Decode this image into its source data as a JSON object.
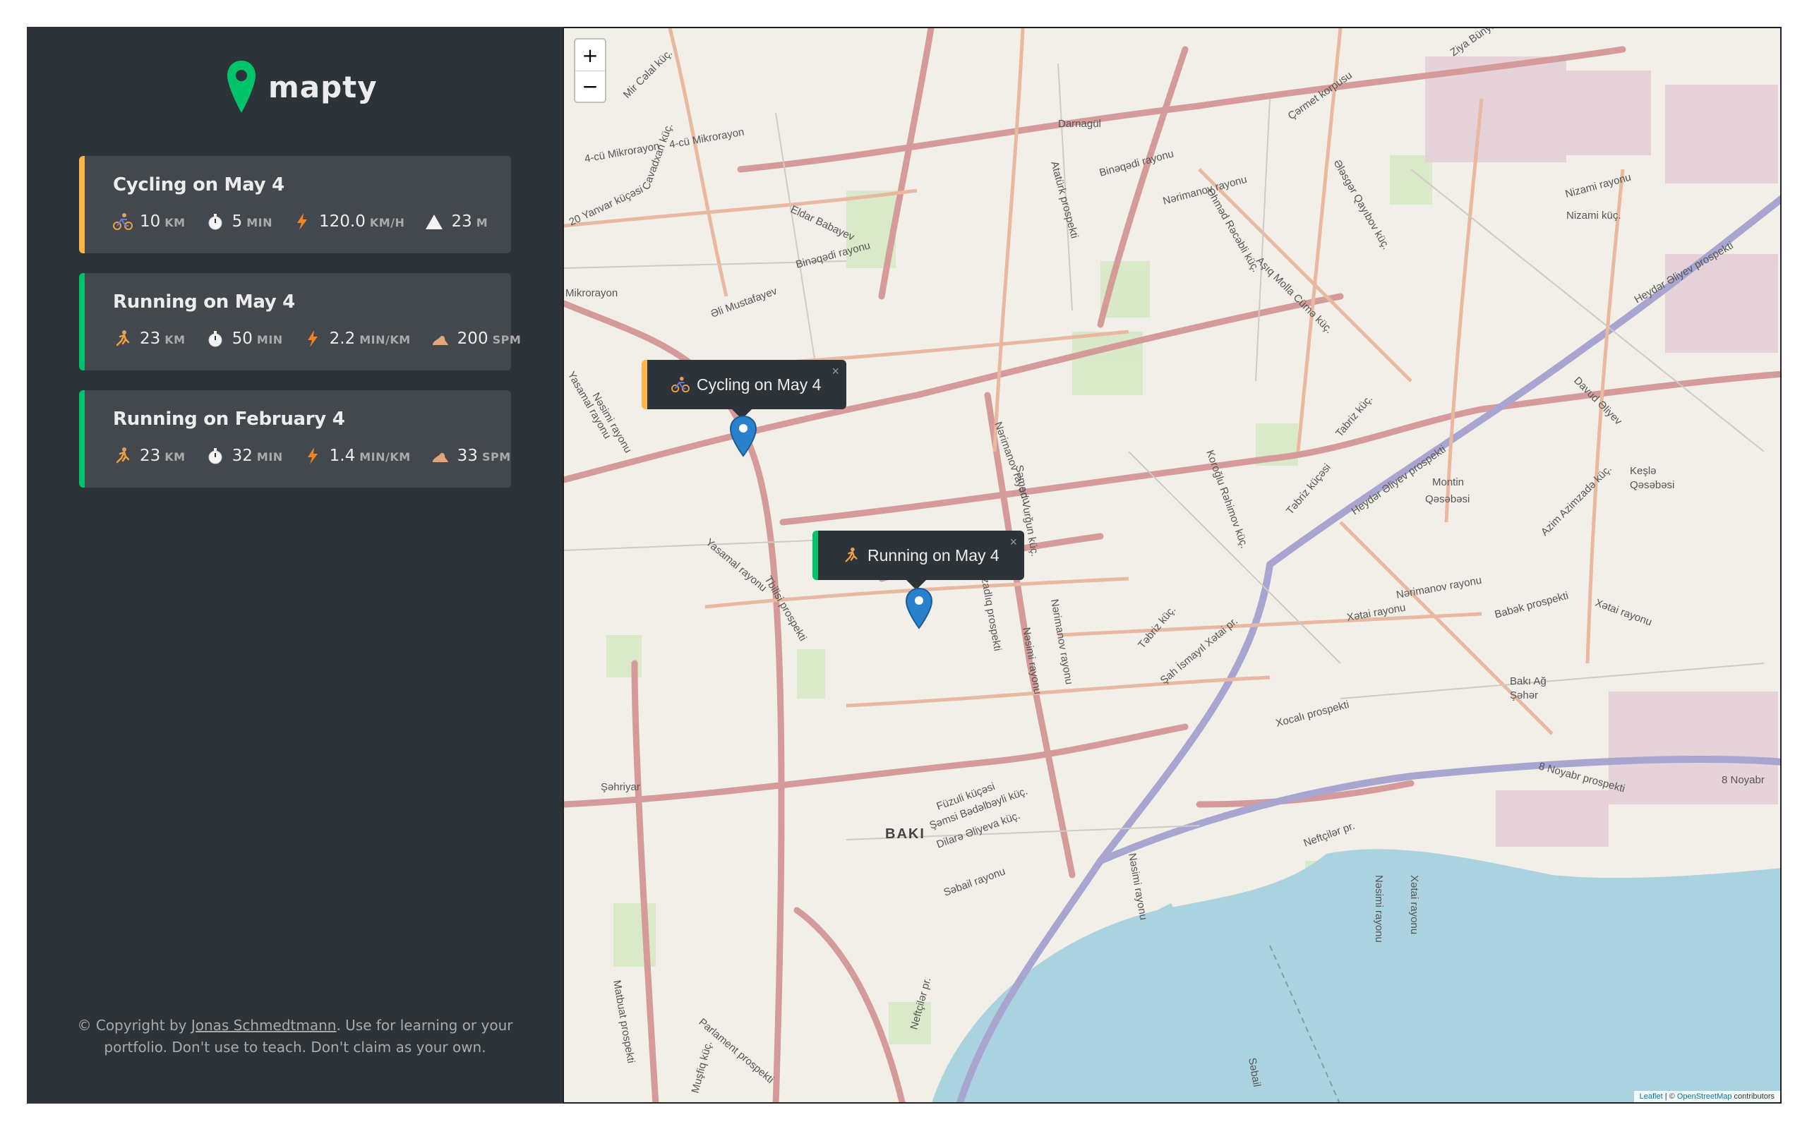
{
  "app": {
    "name": "mapty"
  },
  "colors": {
    "sidebar_bg": "#2d3439",
    "card_bg": "#42484d",
    "cycling": "#ffb545",
    "running": "#00c46a",
    "marker": "#2a81cb",
    "water": "#aad3df"
  },
  "workouts": [
    {
      "type": "cycling",
      "title": "Cycling on May 4",
      "icon": "cyclist-icon",
      "details": [
        {
          "icon": "cyclist-icon",
          "value": "10",
          "unit": "km"
        },
        {
          "icon": "stopwatch-icon",
          "value": "5",
          "unit": "min"
        },
        {
          "icon": "lightning-icon",
          "value": "120.0",
          "unit": "km/h"
        },
        {
          "icon": "mountain-icon",
          "value": "23",
          "unit": "m"
        }
      ]
    },
    {
      "type": "running",
      "title": "Running on May 4",
      "icon": "runner-icon",
      "details": [
        {
          "icon": "runner-icon",
          "value": "23",
          "unit": "km"
        },
        {
          "icon": "stopwatch-icon",
          "value": "50",
          "unit": "min"
        },
        {
          "icon": "lightning-icon",
          "value": "2.2",
          "unit": "min/km"
        },
        {
          "icon": "footprint-icon",
          "value": "200",
          "unit": "spm"
        }
      ]
    },
    {
      "type": "running",
      "title": "Running on February 4",
      "icon": "runner-icon",
      "details": [
        {
          "icon": "runner-icon",
          "value": "23",
          "unit": "km"
        },
        {
          "icon": "stopwatch-icon",
          "value": "32",
          "unit": "min"
        },
        {
          "icon": "lightning-icon",
          "value": "1.4",
          "unit": "min/km"
        },
        {
          "icon": "footprint-icon",
          "value": "33",
          "unit": "spm"
        }
      ]
    }
  ],
  "copyright": {
    "prefix": "© Copyright by ",
    "link": "Jonas Schmedtmann",
    "suffix": ". Use for learning or your portfolio. Don't use to teach. Don't claim as your own."
  },
  "map": {
    "zoom_in": "+",
    "zoom_out": "−",
    "popups": [
      {
        "type": "cycling",
        "label": "Cycling on May 4",
        "icon": "cyclist-icon",
        "close": "×"
      },
      {
        "type": "running",
        "label": "Running on May 4",
        "icon": "runner-icon",
        "close": "×"
      }
    ],
    "labels": [
      "Darnagül",
      "4-cü Mikrorayon",
      "4-cü Mikrorayon",
      "Mir Cəlal küç.",
      "20 Yanvar küçəsi",
      "Cavadxan küç.",
      "Eldar Babayev",
      "Binəqədi rayonu",
      "Binəqədi rayonu",
      "Nərimanov rayonu",
      "Atatürk prospekti",
      "Əhməd Rəcəbli küç.",
      "Aşıq Molla Cümə küç.",
      "Çərmet korpusu",
      "Ziya Bünyad",
      "Nizami rayonu",
      "Ələsgər Qayıbov küç.",
      "Heydər Əliyev prospekti",
      "Mikrorayon",
      "Əli Mustafayev",
      "Yasamal rayonu",
      "Nəsimi rayonu",
      "Nərimanov rayonu",
      "Səməd Vurğun küç.",
      "Koroğlu Rəhimov küç.",
      "Təbriz küçəsi",
      "Tabriz küç.",
      "Heydər Əliyev prospekti",
      "Montin",
      "Qəsəbəsi",
      "Keşlə",
      "Qəsəbəsi",
      "Nərimanov rayonu",
      "Xətai rayonu",
      "Babək prospekti",
      "Xətai rayonu",
      "Yasamal rayonu",
      "Tbilisi prospekti",
      "Azadlıq prospekti",
      "Nərimanov rayonu",
      "Nəsimi rayonu",
      "Təbriz küç.",
      "Şah İsmayıl Xətai pr.",
      "Bakı Ağ",
      "Şəhər",
      "Xocalı prospekti",
      "Şəhriyar",
      "BAKI",
      "Füzuli küçəsi",
      "Şəmsi Bədəlbəyli küç.",
      "Dilarə Əliyeva küç.",
      "Səbail rayonu",
      "Nəsimi rayonu",
      "Neftçilər pr.",
      "8 Noyabr prospekti",
      "8 Noyabr",
      "Matbuat prospekti",
      "Parlament prospekti",
      "Neftçilər pr.",
      "Muşfiq küç.",
      "Nəsimi rayonu",
      "Xətai rayonu",
      "Səbail",
      "Davud Əliyev",
      "Azim Azimzadə küç.",
      "Nizami küç."
    ],
    "attribution": {
      "leaflet": "Leaflet",
      "sep": " | © ",
      "osm": "OpenStreetMap",
      "suffix": " contributors"
    }
  }
}
